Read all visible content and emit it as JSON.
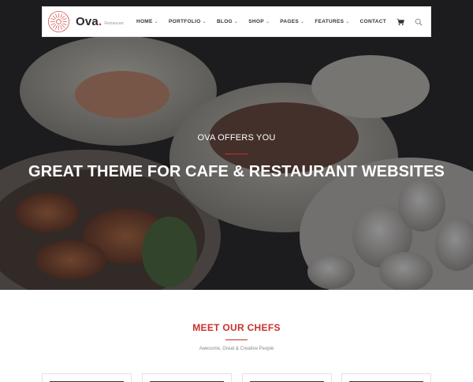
{
  "brand": {
    "name": "Ova",
    "dot": ".",
    "tagline": "Restaurant",
    "accent_color": "#c9302c"
  },
  "nav": {
    "items": [
      {
        "label": "HOME",
        "dropdown": true
      },
      {
        "label": "PORTFOLIO",
        "dropdown": true
      },
      {
        "label": "BLOG",
        "dropdown": true
      },
      {
        "label": "SHOP",
        "dropdown": true
      },
      {
        "label": "PAGES",
        "dropdown": true
      },
      {
        "label": "FEATURES",
        "dropdown": true
      },
      {
        "label": "CONTACT",
        "dropdown": false
      }
    ],
    "icons": [
      "cart-icon",
      "search-icon"
    ]
  },
  "hero": {
    "subtitle": "OVA OFFERS YOU",
    "title": "GREAT THEME FOR CAFE & RESTAURANT WEBSITES"
  },
  "chefs": {
    "title": "MEET OUR CHEFS",
    "subtitle": "Awesome, Great & Creative People"
  }
}
